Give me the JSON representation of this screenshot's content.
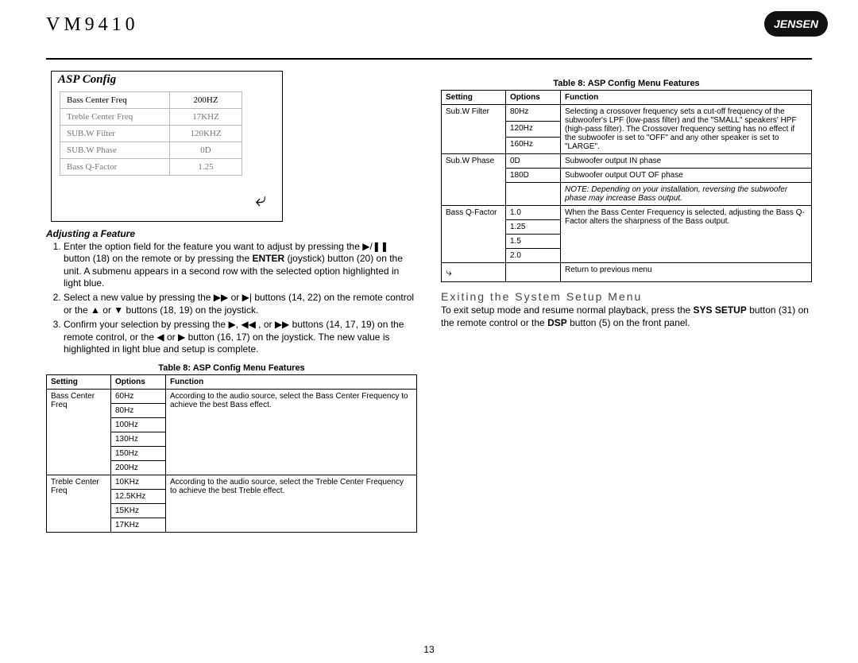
{
  "model": "VM9410",
  "logo_text": "JENSEN",
  "page_number": "13",
  "asp": {
    "title": "ASP Config",
    "return_glyph": "⤶",
    "rows": [
      {
        "label": "Bass Center Freq",
        "value": "200HZ",
        "hilite": true
      },
      {
        "label": "Treble Center Freq",
        "value": "17KHZ"
      },
      {
        "label": "SUB.W Filter",
        "value": "120KHZ"
      },
      {
        "label": "SUB.W Phase",
        "value": "0D"
      },
      {
        "label": "Bass Q-Factor",
        "value": "1.25"
      }
    ]
  },
  "adjust_heading": "Adjusting a Feature",
  "steps": {
    "s1a": "Enter the option field for the feature you want to adjust by pressing the ",
    "s1_btn18": " button (18) on the remote or by pressing the ",
    "s1_enter": "ENTER",
    "s1b": " (joystick) button (20) on the unit. A submenu appears in a second row with the selected option highlighted in light blue.",
    "s2a": "Select a new value by pressing the ",
    "s2b": " buttons (14, 22) on the remote control or the ",
    "s2c": " buttons (18, 19) on the joystick.",
    "s3a": "Confirm your selection by pressing the ",
    "s3b": " buttons (14, 17, 19) on the remote control, or the ",
    "s3c": " button (16, 17) on the joystick. The new value is highlighted in light blue and setup is complete."
  },
  "glyphs": {
    "play": "▶",
    "playpause": "▶/❚❚",
    "ff": "▶▶",
    "rw": "◀◀",
    "fplay": "▶|",
    "up": "▲",
    "down": "▼",
    "left": "◀",
    "right": "▶"
  },
  "conj_or": " or ",
  "comma_or": ", or ",
  "table_caption": "Table 8: ASP Config Menu Features",
  "table_headers": {
    "setting": "Setting",
    "options": "Options",
    "function": "Function"
  },
  "t_left": [
    {
      "setting": "Bass Center Freq",
      "opts": [
        "60Hz",
        "80Hz",
        "100Hz",
        "130Hz",
        "150Hz",
        "200Hz"
      ],
      "func": "According to the audio source, select the Bass Center Frequency to achieve the best Bass effect."
    },
    {
      "setting": "Treble Center Freq",
      "opts": [
        "10KHz",
        "12.5KHz",
        "15KHz",
        "17KHz"
      ],
      "func": "According to the audio source, select the Treble Center Frequency to achieve the best Treble effect."
    }
  ],
  "t_right": [
    {
      "setting": "Sub.W Filter",
      "opts": [
        "80Hz",
        "120Hz",
        "160Hz"
      ],
      "func": "Selecting a crossover frequency sets a cut-off frequency of the subwoofer's LPF (low-pass filter) and the \"SMALL\" speakers' HPF (high-pass filter). The Crossover frequency setting has no effect if the subwoofer is set to \"OFF\" and any other speaker is set to \"LARGE\"."
    },
    {
      "setting": "Sub.W Phase",
      "opts": [
        "0D",
        "180D"
      ],
      "funcs": [
        "Subwoofer output IN phase",
        "Subwoofer output OUT OF phase"
      ],
      "note": "NOTE: Depending on your installation, reversing the subwoofer phase may increase Bass output."
    },
    {
      "setting": "Bass Q-Factor",
      "opts": [
        "1.0",
        "1.25",
        "1.5",
        "2.0"
      ],
      "func": "When the Bass Center Frequency is selected, adjusting the Bass Q-Factor alters the sharpness of the Bass output."
    }
  ],
  "return_row_label": "Return to previous menu",
  "exit_heading": "Exiting the System Setup Menu",
  "exit_p_a": "To exit setup mode and resume normal playback, press the ",
  "exit_sys": "SYS SETUP",
  "exit_p_b": " button (31) on the remote control or the ",
  "exit_dsp": "DSP",
  "exit_p_c": " button (5) on the front panel."
}
